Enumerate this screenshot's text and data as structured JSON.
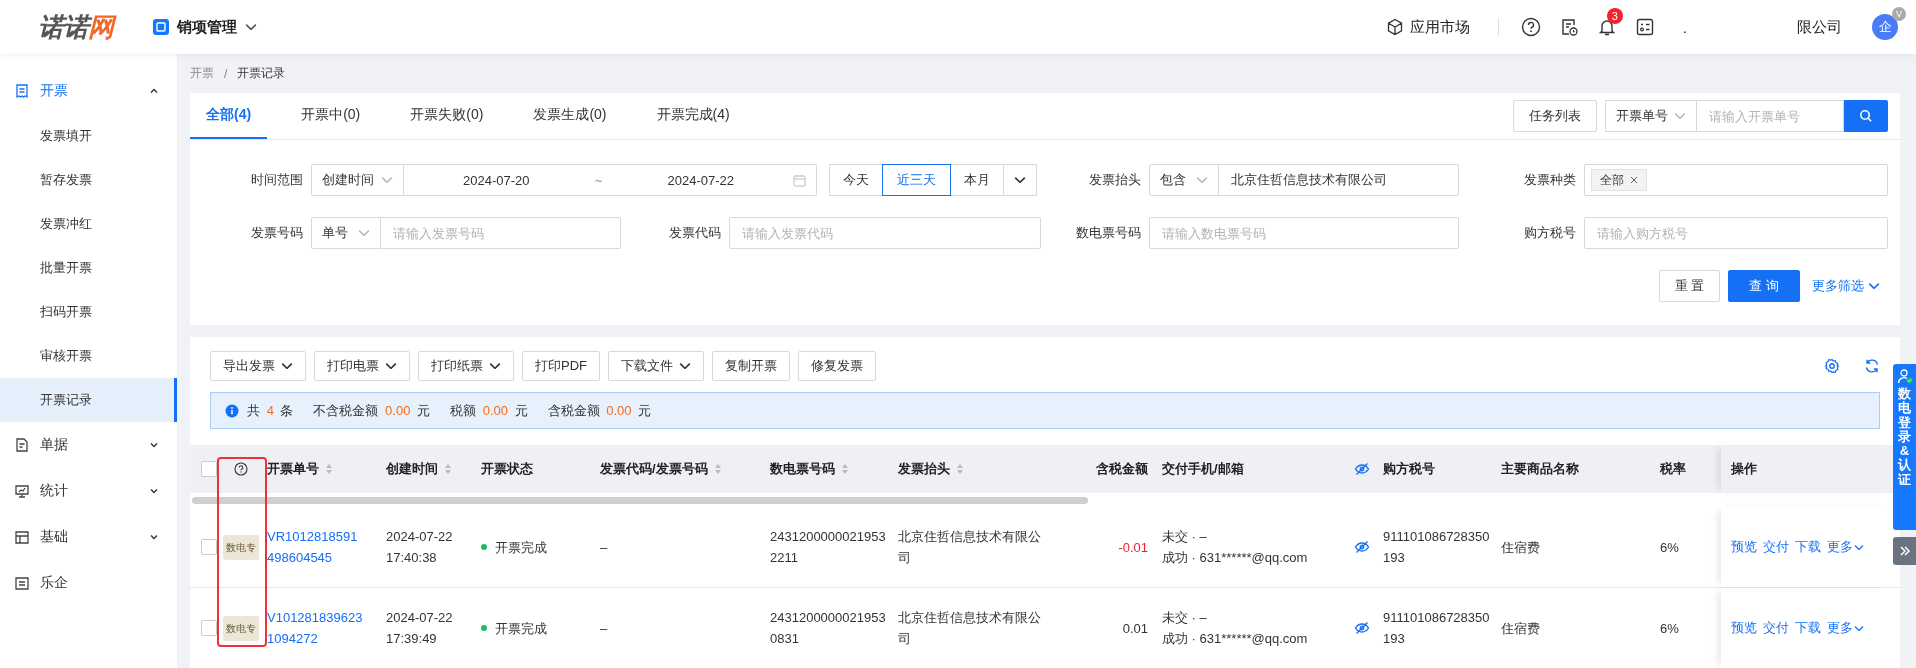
{
  "header": {
    "logo": {
      "main": "诺诺",
      "accent": "网"
    },
    "app": {
      "label": "销项管理"
    },
    "market": {
      "label": "应用市场"
    },
    "notifications": {
      "count": "3"
    },
    "company": {
      "prefix": ".",
      "suffix": "限公司"
    },
    "avatar": {
      "label": "企",
      "badge": "V"
    }
  },
  "sidebar": {
    "items": [
      {
        "label": "开票",
        "expanded": true,
        "children": [
          {
            "label": "发票填开",
            "selected": false
          },
          {
            "label": "暂存发票",
            "selected": false
          },
          {
            "label": "发票冲红",
            "selected": false
          },
          {
            "label": "批量开票",
            "selected": false
          },
          {
            "label": "扫码开票",
            "selected": false
          },
          {
            "label": "审核开票",
            "selected": false
          },
          {
            "label": "开票记录",
            "selected": true
          }
        ]
      },
      {
        "label": "单据",
        "expanded": false
      },
      {
        "label": "统计",
        "expanded": false
      },
      {
        "label": "基础",
        "expanded": false
      },
      {
        "label": "乐企"
      }
    ]
  },
  "breadcrumb": {
    "items": [
      "开票",
      "开票记录"
    ],
    "separator": "/"
  },
  "tabs": [
    {
      "label": "全部(4)",
      "selected": true
    },
    {
      "label": "开票中(0)",
      "selected": false
    },
    {
      "label": "开票失败(0)",
      "selected": false
    },
    {
      "label": "发票生成(0)",
      "selected": false
    },
    {
      "label": "开票完成(4)",
      "selected": false
    }
  ],
  "task_button": "任务列表",
  "search": {
    "field": "开票单号",
    "placeholder": "请输入开票单号"
  },
  "filters": [
    {
      "kind": "time",
      "label": "时间范围",
      "select": "创建时间",
      "start": "2024-07-20",
      "separator": "~",
      "end": "2024-07-22",
      "quick": [
        {
          "label": "今天",
          "selected": false
        },
        {
          "label": "近三天",
          "selected": true
        },
        {
          "label": "本月",
          "selected": false
        }
      ]
    },
    {
      "kind": "select_text",
      "label": "发票抬头",
      "select": "包含",
      "value": "北京住哲信息技术有限公司"
    },
    {
      "kind": "tags",
      "label": "发票种类",
      "tags": [
        "全部"
      ]
    },
    {
      "kind": "select_text",
      "label": "发票号码",
      "select": "单号",
      "placeholder": "请输入发票号码"
    },
    {
      "kind": "text",
      "label": "发票代码",
      "placeholder": "请输入发票代码"
    },
    {
      "kind": "text",
      "label": "数电票号码",
      "placeholder": "请输入数电票号码"
    },
    {
      "kind": "text",
      "label": "购方税号",
      "placeholder": "请输入购方税号"
    }
  ],
  "filter_actions": {
    "reset": "重 置",
    "query": "查 询",
    "more": "更多筛选"
  },
  "toolbar": [
    {
      "label": "导出发票",
      "dropdown": true
    },
    {
      "label": "打印电票",
      "dropdown": true
    },
    {
      "label": "打印纸票",
      "dropdown": true
    },
    {
      "label": "打印PDF",
      "dropdown": false
    },
    {
      "label": "下载文件",
      "dropdown": true
    },
    {
      "label": "复制开票",
      "dropdown": false
    },
    {
      "label": "修复发票",
      "dropdown": false
    }
  ],
  "summary": [
    {
      "label": "共",
      "value": "4",
      "unit": "条"
    },
    {
      "label": "不含税金额",
      "value": "0.00",
      "unit": "元"
    },
    {
      "label": "税额",
      "value": "0.00",
      "unit": "元"
    },
    {
      "label": "含税金额",
      "value": "0.00",
      "unit": "元"
    }
  ],
  "table": {
    "all_checked": false,
    "columns": [
      {
        "kind": "checkbox",
        "highlighted": false
      },
      {
        "kind": "help",
        "highlighted": true
      },
      {
        "kind": "text",
        "label": "开票单号",
        "sortable": true,
        "highlighted": false
      },
      {
        "kind": "text",
        "label": "创建时间",
        "sortable": true,
        "highlighted": false
      },
      {
        "kind": "text",
        "label": "开票状态",
        "sortable": false,
        "highlighted": false
      },
      {
        "kind": "text",
        "label": "发票代码/发票号码",
        "sortable": true,
        "highlighted": false
      },
      {
        "kind": "text",
        "label": "数电票号码",
        "sortable": true,
        "highlighted": false
      },
      {
        "kind": "text",
        "label": "发票抬头",
        "sortable": true,
        "highlighted": false
      },
      {
        "kind": "amount",
        "label": "含税金额",
        "sortable": false,
        "highlighted": false
      },
      {
        "kind": "text",
        "label": "交付手机/邮箱",
        "sortable": false,
        "highlighted": false
      },
      {
        "kind": "eye",
        "highlighted": false
      },
      {
        "kind": "text",
        "label": "购方税号",
        "sortable": false,
        "highlighted": false
      },
      {
        "kind": "text",
        "label": "主要商品名称",
        "sortable": false,
        "highlighted": false
      },
      {
        "kind": "text",
        "label": "税率",
        "sortable": false,
        "highlighted": false
      },
      {
        "kind": "text",
        "label": "操作",
        "sortable": false,
        "highlighted": false
      }
    ],
    "rows": [
      {
        "checked": false,
        "tag": "数电专",
        "number": "VR1012818591498604545",
        "date": "2024-07-22",
        "time": "17:40:38",
        "status": {
          "label": "开票完成",
          "color": "#19be6b"
        },
        "code": "–",
        "e_number": "24312000000219532211",
        "title": "北京住哲信息技术有限公司",
        "amount": "-0.01",
        "negative": true,
        "delivery": [
          "未交 · –",
          "成功 · 631******@qq.com"
        ],
        "tax_id": "911101086728350193",
        "goods": "住宿费",
        "rate": "6%",
        "actions": [
          "预览",
          "交付",
          "下载",
          "更多"
        ]
      },
      {
        "checked": false,
        "tag": "数电专",
        "number": "V1012818396231094272",
        "date": "2024-07-22",
        "time": "17:39:49",
        "status": {
          "label": "开票完成",
          "color": "#19be6b"
        },
        "code": "–",
        "e_number": "24312000000219530831",
        "title": "北京住哲信息技术有限公司",
        "amount": "0.01",
        "negative": false,
        "delivery": [
          "未交 · –",
          "成功 · 631******@qq.com"
        ],
        "tax_id": "911101086728350193",
        "goods": "住宿费",
        "rate": "6%",
        "actions": [
          "预览",
          "交付",
          "下载",
          "更多"
        ]
      }
    ]
  },
  "side_panel": {
    "label": "数电登录&认证"
  }
}
